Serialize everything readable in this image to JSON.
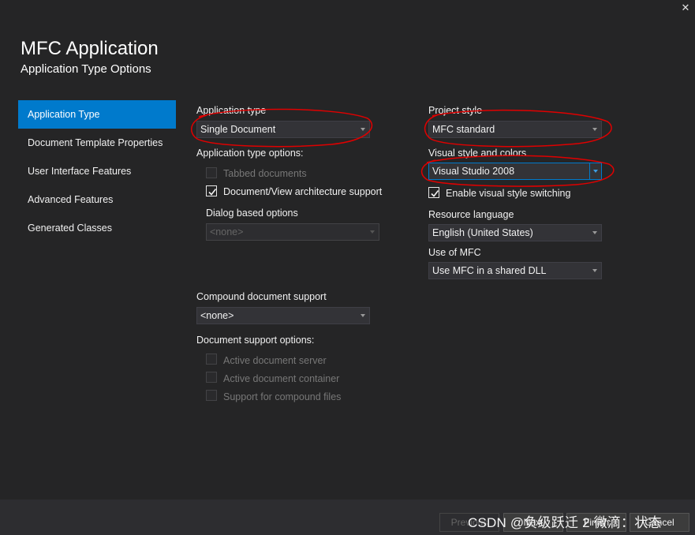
{
  "window": {
    "title": "MFC Application",
    "subtitle": "Application Type Options",
    "close_glyph": "✕"
  },
  "nav": {
    "items": [
      {
        "label": "Application Type",
        "active": true
      },
      {
        "label": "Document Template Properties",
        "active": false
      },
      {
        "label": "User Interface Features",
        "active": false
      },
      {
        "label": "Advanced Features",
        "active": false
      },
      {
        "label": "Generated Classes",
        "active": false
      }
    ]
  },
  "left": {
    "app_type_label": "Application type",
    "app_type_value": "Single Document",
    "app_type_options_label": "Application type options:",
    "tabbed_documents": {
      "label": "Tabbed documents",
      "checked": false,
      "enabled": false
    },
    "doc_view_support": {
      "label": "Document/View architecture support",
      "checked": true,
      "enabled": true
    },
    "dialog_based_label": "Dialog based options",
    "dialog_based_value": "<none>",
    "compound_label": "Compound document support",
    "compound_value": "<none>",
    "doc_support_label": "Document support options:",
    "active_doc_server": {
      "label": "Active document server",
      "checked": false,
      "enabled": false
    },
    "active_doc_container": {
      "label": "Active document container",
      "checked": false,
      "enabled": false
    },
    "compound_files": {
      "label": "Support for compound files",
      "checked": false,
      "enabled": false
    }
  },
  "right": {
    "project_style_label": "Project style",
    "project_style_value": "MFC standard",
    "visual_style_label": "Visual style and colors",
    "visual_style_value": "Visual Studio 2008",
    "enable_switching": {
      "label": "Enable visual style switching",
      "checked": true,
      "enabled": true
    },
    "resource_lang_label": "Resource language",
    "resource_lang_value": "English (United States)",
    "use_mfc_label": "Use of MFC",
    "use_mfc_value": "Use MFC in a shared DLL"
  },
  "footer": {
    "previous": "Previous",
    "next": "Next",
    "finish": "Finish",
    "cancel": "Cancel"
  },
  "watermark": "CSDN @负级跃迁 2 微滴：状态",
  "colors": {
    "background": "#252526",
    "accent": "#007acc",
    "annotation": "#e00000"
  }
}
